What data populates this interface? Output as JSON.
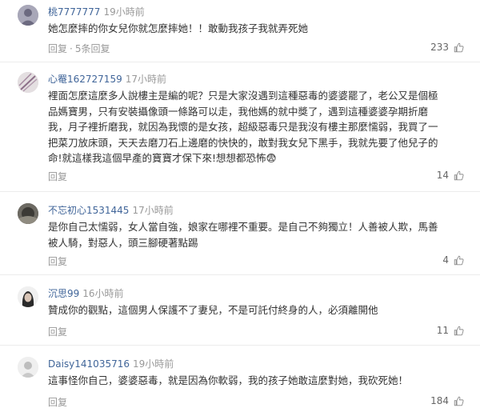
{
  "comments": [
    {
      "username": "桃7777777",
      "time": "19小時前",
      "text": "她怎麼摔的你女兒你就怎麼摔她！！敢動我孩子我就弄死她",
      "reply_label": "回复",
      "replies_label": "5条回复",
      "likes": "233"
    },
    {
      "username": "心罨162727159",
      "time": "17小時前",
      "text": "裡面怎麼這麼多人說樓主是編的呢？只是大家沒遇到這種惡毒的婆婆罷了，老公又是個極品媽寶男，只有安裝攝像頭一條路可以走，我他媽的就中獎了，遇到這種婆婆孕期折磨我，月子裡折磨我，就因為我懷的是女孩，超級惡毒只是我沒有樓主那麼懦弱，我買了一把菜刀放床頭，天天去磨刀石上邊磨的快快的，敢對我女兒下黑手，我就先要了他兒子的命!就這樣我這個早產的寶寶才保下來!想想都恐怖😨",
      "reply_label": "回复",
      "likes": "14"
    },
    {
      "username": "不忘初心1531445",
      "time": "17小時前",
      "text": "是你自己太懦弱，女人當自強，娘家在哪裡不重要。是自己不夠獨立！人善被人欺，馬善被人騎，對惡人，頭三腳硬著點踢",
      "reply_label": "回复",
      "likes": "4"
    },
    {
      "username": "沉思99",
      "time": "16小時前",
      "text": "贊成你的觀點，這個男人保護不了妻兒，不是可託付終身的人，必須離開他",
      "reply_label": "回复",
      "likes": "11"
    },
    {
      "username": "Daisy141035716",
      "time": "19小時前",
      "text": "這事怪你自己，婆婆惡毒，就是因為你軟弱，我的孩子她敢這麼對她，我砍死她！",
      "reply_label": "回复",
      "likes": "184"
    }
  ],
  "colors": {
    "username": "#406599",
    "meta_gray": "#999999",
    "divider": "#ececec"
  },
  "icons": {
    "like": "thumbs-up-icon"
  }
}
